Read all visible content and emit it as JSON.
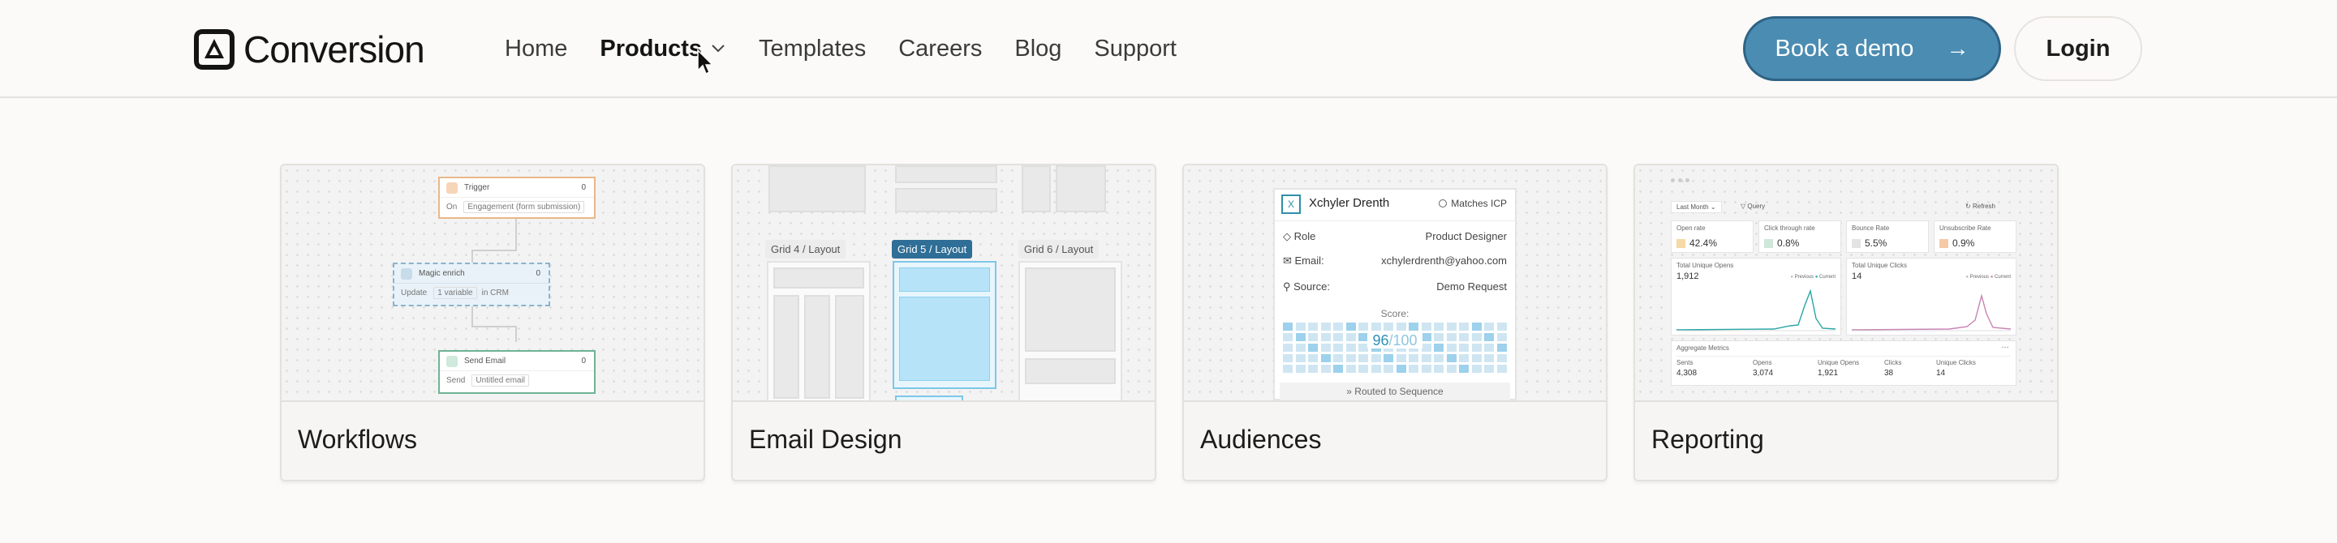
{
  "brand": {
    "name": "Conversion"
  },
  "nav": {
    "items": [
      {
        "label": "Home"
      },
      {
        "label": "Products",
        "active": true
      },
      {
        "label": "Templates"
      },
      {
        "label": "Careers"
      },
      {
        "label": "Blog"
      },
      {
        "label": "Support"
      }
    ]
  },
  "actions": {
    "demo_label": "Book a demo",
    "login_label": "Login"
  },
  "colors": {
    "accent": "#4b8cb3",
    "accent_border": "#2e6385",
    "background": "#fbfaf8"
  },
  "cards": [
    {
      "label": "Workflows",
      "nodes": [
        {
          "title": "Trigger",
          "count": "0",
          "row_key": "On",
          "row_value": "Engagement (form submission)"
        },
        {
          "title": "Magic enrich",
          "count": "0",
          "row_key": "Update",
          "row_value": "1 variable",
          "row_extra": "in CRM"
        },
        {
          "title": "Send Email",
          "count": "0",
          "row_key": "Send",
          "row_value": "Untitled email"
        }
      ]
    },
    {
      "label": "Email Design",
      "tags": [
        "Grid 4 / Layout",
        "Grid 5 / Layout",
        "Grid 6 / Layout"
      ]
    },
    {
      "label": "Audiences",
      "name": "Xchyler Drenth",
      "avatar_letter": "X",
      "badge": "Matches ICP",
      "rows": [
        {
          "key": "Role",
          "value": "Product Designer"
        },
        {
          "key": "Email:",
          "value": "xchylerdrenth@yahoo.com"
        },
        {
          "key": "Source:",
          "value": "Demo Request"
        }
      ],
      "score_label": "Score:",
      "score_value": "96",
      "score_total": "/100",
      "footer": "Routed to Sequence"
    },
    {
      "label": "Reporting",
      "filter": "Last Month",
      "query": "Query",
      "refresh": "Refresh",
      "metrics": [
        {
          "name": "Open rate",
          "value": "42.4%"
        },
        {
          "name": "Click through rate",
          "value": "0.8%"
        },
        {
          "name": "Bounce Rate",
          "value": "5.5%"
        },
        {
          "name": "Unsubscribe Rate",
          "value": "0.9%"
        }
      ],
      "charts": [
        {
          "title": "Total Unique Opens",
          "value": "1,912",
          "legend_prev": "Previous",
          "legend_curr": "Current"
        },
        {
          "title": "Total Unique Clicks",
          "value": "14",
          "legend_prev": "Previous",
          "legend_curr": "Current"
        }
      ],
      "aggregate_title": "Aggregate Metrics",
      "aggregates": [
        {
          "name": "Sents",
          "value": "4,308"
        },
        {
          "name": "Opens",
          "value": "3,074"
        },
        {
          "name": "Unique Opens",
          "value": "1,921"
        },
        {
          "name": "Clicks",
          "value": "38"
        },
        {
          "name": "Unique Clicks",
          "value": "14"
        }
      ]
    }
  ]
}
